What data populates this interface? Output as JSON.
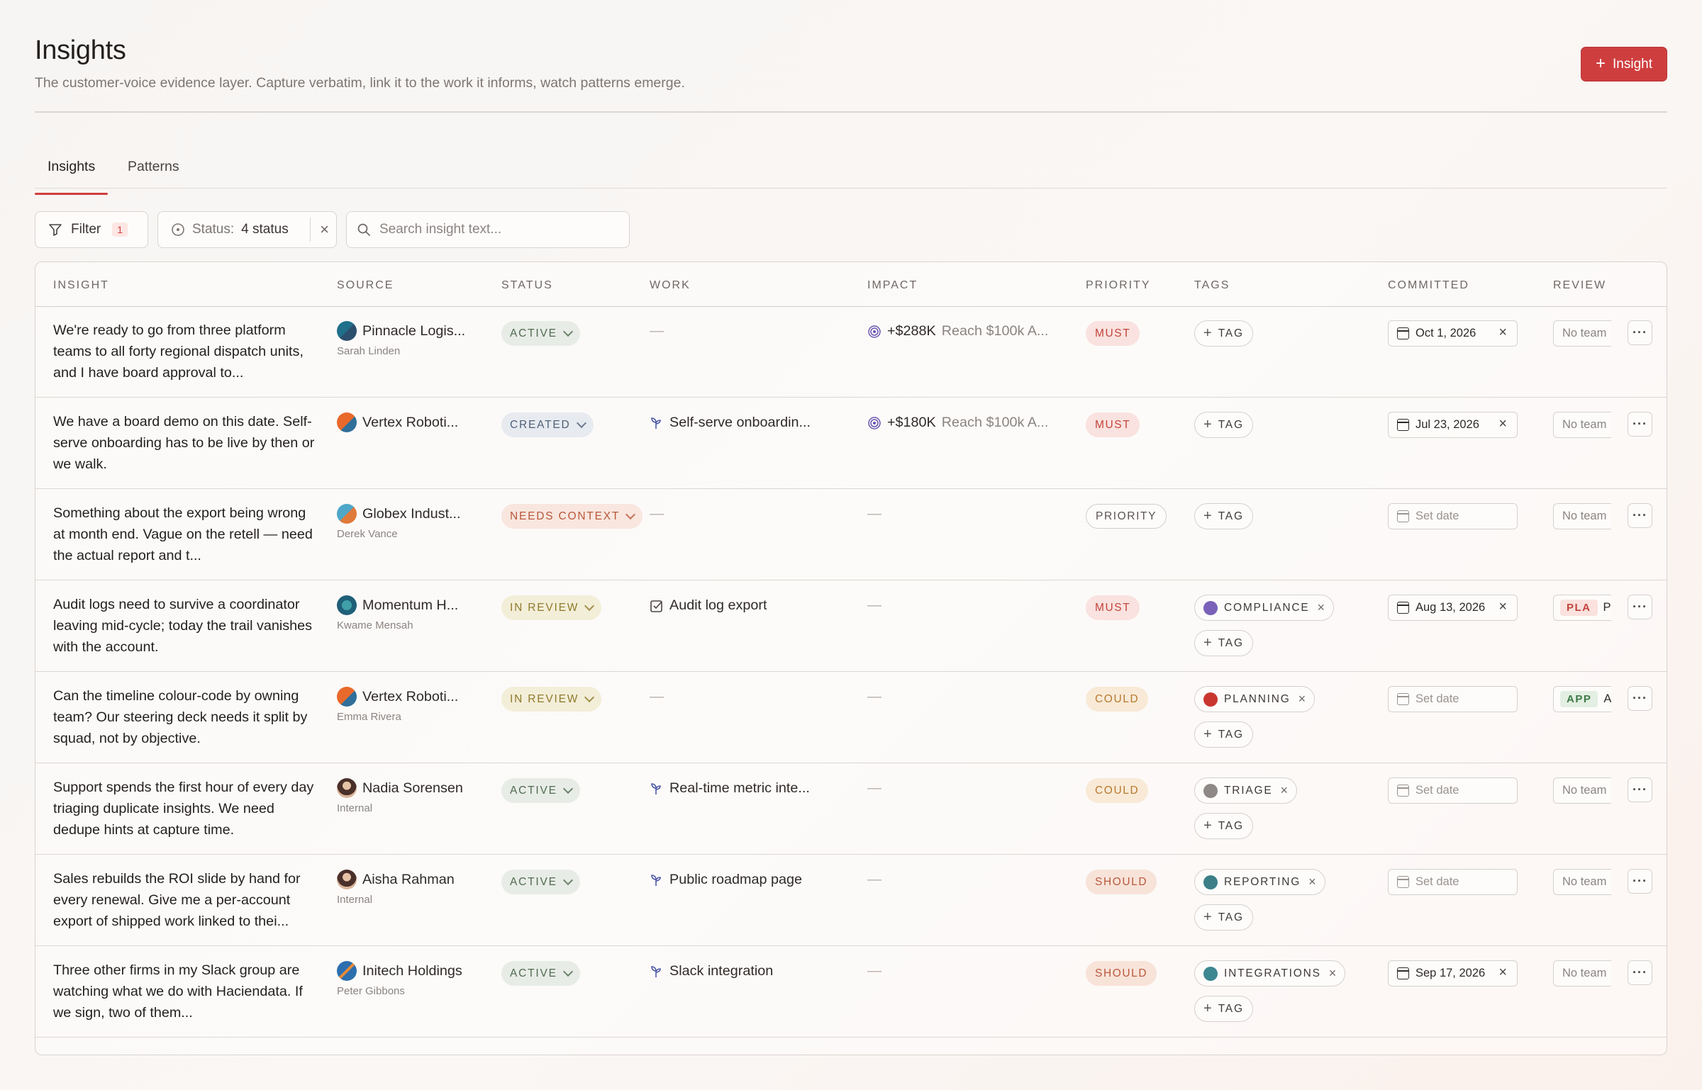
{
  "header": {
    "title": "Insights",
    "subtitle": "The customer-voice evidence layer. Capture verbatim, link it to the work it informs, watch patterns emerge.",
    "new_button": "Insight"
  },
  "tabs": [
    {
      "label": "Insights",
      "active": true
    },
    {
      "label": "Patterns",
      "active": false
    }
  ],
  "toolbar": {
    "filter_label": "Filter",
    "filter_count": "1",
    "status_label": "Status:",
    "status_value": "4 status",
    "search_placeholder": "Search insight text..."
  },
  "columns": [
    "INSIGHT",
    "SOURCE",
    "STATUS",
    "WORK",
    "IMPACT",
    "PRIORITY",
    "TAGS",
    "COMMITTED",
    "REVIEW"
  ],
  "colors": {
    "accent": "#cf3e3e",
    "tag_compliance": "#7a62b8",
    "tag_planning": "#c9362f",
    "tag_triage": "#8e8886",
    "tag_reporting": "#3d7f86",
    "tag_integrations": "#3d8790"
  },
  "rows": [
    {
      "insight": "We're ready to go from three platform teams to all forty regional dispatch units, and I have board approval to...",
      "source_name": "Pinnacle Logis...",
      "source_sub": "Sarah Linden",
      "avatar_icon": "company-logo-blue",
      "status": "ACTIVE",
      "work": "",
      "work_icon": "",
      "impact_amount": "+$288K",
      "impact_goal": "Reach $100k A...",
      "priority": "MUST",
      "tags": [],
      "add_tag": "TAG",
      "committed": "Oct 1, 2026",
      "committed_set": true,
      "review": "No team",
      "review_team": "",
      "review_extra": ""
    },
    {
      "insight": "We have a board demo on this date. Self-serve onboarding has to be live by then or we walk.",
      "source_name": "Vertex Roboti...",
      "source_sub": "",
      "avatar_icon": "company-logo-orange",
      "status": "CREATED",
      "work": "Self-serve onboardin...",
      "work_icon": "sprout-icon",
      "impact_amount": "+$180K",
      "impact_goal": "Reach $100k A...",
      "priority": "MUST",
      "tags": [],
      "add_tag": "TAG",
      "committed": "Jul 23, 2026",
      "committed_set": true,
      "review": "No team",
      "review_team": "",
      "review_extra": ""
    },
    {
      "insight": "Something about the export being wrong at month end. Vague on the retell — need the actual report and t...",
      "source_name": "Globex Indust...",
      "source_sub": "Derek Vance",
      "avatar_icon": "company-logo-teal",
      "status": "NEEDS CONTEXT",
      "work": "",
      "work_icon": "",
      "impact_amount": "",
      "impact_goal": "",
      "priority": "PRIORITY",
      "tags": [],
      "add_tag": "TAG",
      "committed": "Set date",
      "committed_set": false,
      "review": "No team",
      "review_team": "",
      "review_extra": ""
    },
    {
      "insight": "Audit logs need to survive a coordinator leaving mid-cycle; today the trail vanishes with the account.",
      "source_name": "Momentum H...",
      "source_sub": "Kwame Mensah",
      "avatar_icon": "company-logo-teal-diamond",
      "status": "IN REVIEW",
      "work": "Audit log export",
      "work_icon": "checkbox-icon",
      "impact_amount": "",
      "impact_goal": "",
      "priority": "MUST",
      "tags": [
        {
          "label": "COMPLIANCE",
          "color": "#7a62b8"
        }
      ],
      "add_tag": "TAG",
      "committed": "Aug 13, 2026",
      "committed_set": true,
      "review": "",
      "review_team": "PLA",
      "review_extra": "P"
    },
    {
      "insight": "Can the timeline colour-code by owning team? Our steering deck needs it split by squad, not by objective.",
      "source_name": "Vertex Roboti...",
      "source_sub": "Emma Rivera",
      "avatar_icon": "company-logo-orange",
      "status": "IN REVIEW",
      "work": "",
      "work_icon": "",
      "impact_amount": "",
      "impact_goal": "",
      "priority": "COULD",
      "tags": [
        {
          "label": "PLANNING",
          "color": "#c9362f"
        }
      ],
      "add_tag": "TAG",
      "committed": "Set date",
      "committed_set": false,
      "review": "",
      "review_team": "APP",
      "review_extra": "A"
    },
    {
      "insight": "Support spends the first hour of every day triaging duplicate insights. We need dedupe hints at capture time.",
      "source_name": "Nadia Sorensen",
      "source_sub": "Internal",
      "avatar_icon": "person-avatar",
      "status": "ACTIVE",
      "work": "Real-time metric inte...",
      "work_icon": "sprout-icon",
      "impact_amount": "",
      "impact_goal": "",
      "priority": "COULD",
      "tags": [
        {
          "label": "TRIAGE",
          "color": "#8e8886"
        }
      ],
      "add_tag": "TAG",
      "committed": "Set date",
      "committed_set": false,
      "review": "No team",
      "review_team": "",
      "review_extra": ""
    },
    {
      "insight": "Sales rebuilds the ROI slide by hand for every renewal. Give me a per-account export of shipped work linked to thei...",
      "source_name": "Aisha Rahman",
      "source_sub": "Internal",
      "avatar_icon": "person-avatar",
      "status": "ACTIVE",
      "work": "Public roadmap page",
      "work_icon": "sprout-icon",
      "impact_amount": "",
      "impact_goal": "",
      "priority": "SHOULD",
      "tags": [
        {
          "label": "REPORTING",
          "color": "#3d7f86"
        }
      ],
      "add_tag": "TAG",
      "committed": "Set date",
      "committed_set": false,
      "review": "No team",
      "review_team": "",
      "review_extra": ""
    },
    {
      "insight": "Three other firms in my Slack group are watching what we do with Haciendata. If we sign, two of them...",
      "source_name": "Initech Holdings",
      "source_sub": "Peter Gibbons",
      "avatar_icon": "company-logo-stripe",
      "status": "ACTIVE",
      "work": "Slack integration",
      "work_icon": "sprout-icon",
      "impact_amount": "",
      "impact_goal": "",
      "priority": "SHOULD",
      "tags": [
        {
          "label": "INTEGRATIONS",
          "color": "#3d8790"
        }
      ],
      "add_tag": "TAG",
      "committed": "Sep 17, 2026",
      "committed_set": true,
      "review": "No team",
      "review_team": "",
      "review_extra": ""
    }
  ]
}
